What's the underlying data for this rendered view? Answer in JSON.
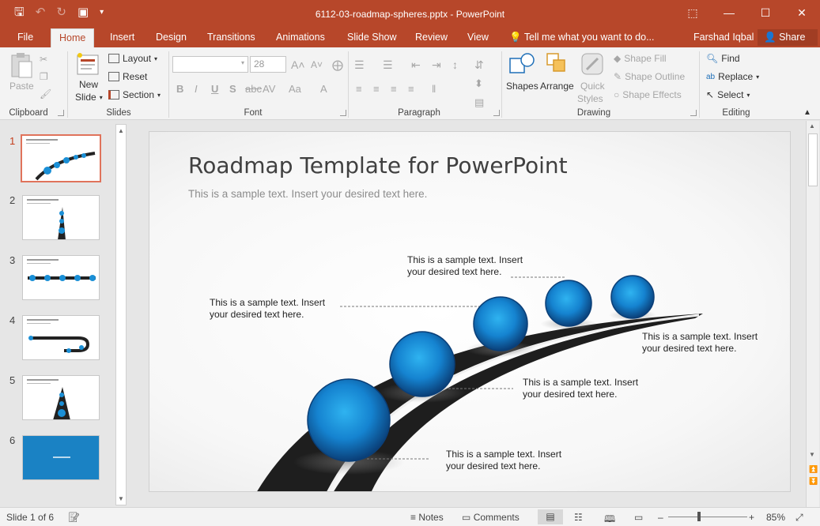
{
  "window": {
    "title": "6112-03-roadmap-spheres.pptx - PowerPoint",
    "restore_icon": "ribbon-display-icon",
    "min_icon": "minimize-icon",
    "max_icon": "maximize-icon",
    "close_icon": "close-icon"
  },
  "tabs": [
    "File",
    "Home",
    "Insert",
    "Design",
    "Transitions",
    "Animations",
    "Slide Show",
    "Review",
    "View"
  ],
  "tell_me": "Tell me what you want to do...",
  "user": "Farshad Iqbal",
  "share": "Share",
  "ribbon": {
    "clipboard": {
      "paste": "Paste",
      "label": "Clipboard"
    },
    "slides": {
      "new_slide_1": "New",
      "new_slide_2": "Slide",
      "layout": "Layout",
      "reset": "Reset",
      "section": "Section",
      "label": "Slides"
    },
    "font": {
      "font_size": "28",
      "label": "Font"
    },
    "paragraph": {
      "label": "Paragraph"
    },
    "drawing": {
      "shapes": "Shapes",
      "arrange": "Arrange",
      "quick_1": "Quick",
      "quick_2": "Styles",
      "fill": "Shape Fill",
      "outline": "Shape Outline",
      "effects": "Shape Effects",
      "label": "Drawing"
    },
    "editing": {
      "find": "Find",
      "replace": "Replace",
      "select": "Select",
      "label": "Editing"
    }
  },
  "thumbnails": [
    "1",
    "2",
    "3",
    "4",
    "5",
    "6"
  ],
  "slide": {
    "title": "Roadmap Template for PowerPoint",
    "subtitle": "This is a sample text. Insert your desired text here.",
    "callouts": [
      "This is a sample text. Insert your desired text here.",
      "This is a sample text. Insert your desired text here.",
      "This is a sample text. Insert your desired text here.",
      "This is a sample text. Insert your desired text here.",
      "This is a sample text. Insert your desired text here."
    ]
  },
  "status": {
    "slide_of": "Slide 1 of 6",
    "notes": "Notes",
    "comments": "Comments",
    "zoom": "85%"
  },
  "colors": {
    "accent": "#b7472a",
    "sphere": "#1a8fd6",
    "road": "#1e1e1e"
  }
}
